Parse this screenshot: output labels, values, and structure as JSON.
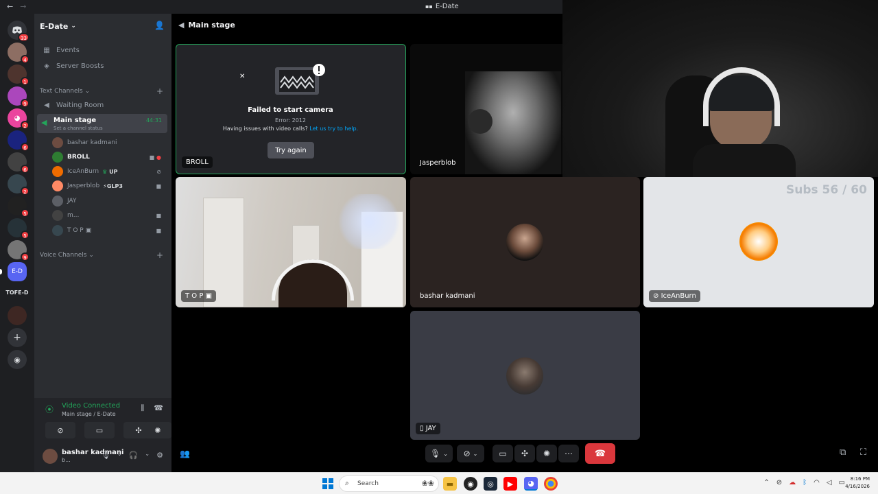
{
  "window": {
    "title": "E-Date"
  },
  "servers": [
    {
      "initials": "",
      "badge": "33"
    },
    {
      "initials": "",
      "badge": "4"
    },
    {
      "initials": "",
      "badge": "1"
    },
    {
      "initials": "",
      "badge": "9"
    },
    {
      "initials": "",
      "badge": "2"
    },
    {
      "initials": "",
      "badge": "6"
    },
    {
      "initials": "",
      "badge": "6"
    },
    {
      "initials": "",
      "badge": "2"
    },
    {
      "initials": "",
      "badge": "5"
    },
    {
      "initials": "",
      "badge": "5"
    },
    {
      "initials": "",
      "badge": "9"
    },
    {
      "initials": "E-D",
      "badge": ""
    }
  ],
  "rail_label": "TOFE-D",
  "sidebar": {
    "server_name": "E-Date",
    "events": "Events",
    "boosts": "Server Boosts",
    "text_channels": "Text Channels",
    "waiting_room": "Waiting Room",
    "main_stage": {
      "name": "Main stage",
      "status": "Set a channel status",
      "time": "44:31"
    },
    "members": [
      {
        "name": "bashar kadmani",
        "extra": "",
        "bold": false,
        "color": "#6d4c41"
      },
      {
        "name": "BROLL",
        "extra": "",
        "bold": true,
        "color": "#2e7d32"
      },
      {
        "name": "IceAnBurn",
        "extra": "UP",
        "bold": false,
        "color": "#ef6c00"
      },
      {
        "name": "Jasperblob",
        "extra": "GLP3",
        "bold": false,
        "color": "#ff8a65"
      },
      {
        "name": "JAY",
        "extra": "",
        "bold": false,
        "color": "#5c5f66"
      },
      {
        "name": "m...",
        "extra": "",
        "bold": false,
        "color": "#424242"
      },
      {
        "name": "T O P",
        "extra": "",
        "bold": false,
        "color": "#37474f"
      }
    ],
    "voice_channels": "Voice Channels"
  },
  "connection": {
    "title": "Video Connected",
    "subtitle": "Main stage / E-Date"
  },
  "user": {
    "name": "bashar kadmani",
    "status": "b..."
  },
  "stage": {
    "header": "Main stage",
    "error": {
      "title": "Failed to start camera",
      "code": "Error: 2012",
      "help": "Having issues with video calls?",
      "link": "Let us try to help.",
      "retry": "Try again"
    },
    "tiles": {
      "broll": "BROLL",
      "jasper": "Jasperblob",
      "top": "T O P",
      "bashar": "bashar kadmani",
      "iceanburn": "IceAnBurn",
      "jay": "JAY"
    },
    "overlay": "Subs 56 / 60"
  },
  "taskbar": {
    "search": "Search",
    "time": "8:16 PM",
    "date": "4/16/2026"
  }
}
